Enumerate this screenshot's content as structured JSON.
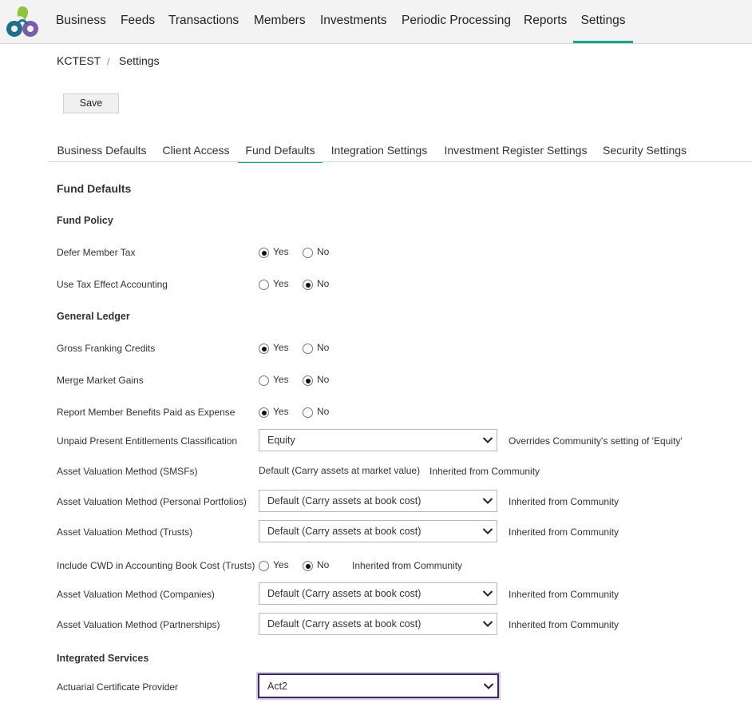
{
  "nav": {
    "items": [
      "Business",
      "Feeds",
      "Transactions",
      "Members",
      "Investments",
      "Periodic Processing",
      "Reports",
      "Settings"
    ],
    "active": "Settings"
  },
  "breadcrumb": {
    "root": "KCTEST",
    "separator": "/",
    "current": "Settings"
  },
  "toolbar": {
    "save_label": "Save"
  },
  "tabs": [
    "Business Defaults",
    "Client Access",
    "Fund Defaults",
    "Integration Settings",
    "Investment Register Settings",
    "Security Settings"
  ],
  "active_tab": "Fund Defaults",
  "section_title": "Fund Defaults",
  "radio_labels": {
    "yes": "Yes",
    "no": "No"
  },
  "fund_policy": {
    "heading": "Fund Policy",
    "defer_member_tax": {
      "label": "Defer Member Tax",
      "value": "Yes"
    },
    "use_tax_effect_accounting": {
      "label": "Use Tax Effect Accounting",
      "value": "No"
    }
  },
  "general_ledger": {
    "heading": "General Ledger",
    "gross_franking_credits": {
      "label": "Gross Franking Credits",
      "value": "Yes"
    },
    "merge_market_gains": {
      "label": "Merge Market Gains",
      "value": "No"
    },
    "report_member_benefits": {
      "label": "Report Member Benefits Paid as Expense",
      "value": "Yes"
    },
    "unpaid_present_entitlements": {
      "label": "Unpaid Present Entitlements Classification",
      "value": "Equity",
      "note": "Overrides Community's setting of 'Equity'"
    },
    "asset_valuation_smsfs": {
      "label": "Asset Valuation Method (SMSFs)",
      "value": "Default (Carry assets at market value)",
      "note": "Inherited from Community"
    },
    "asset_valuation_personal": {
      "label": "Asset Valuation Method (Personal Portfolios)",
      "value": "Default (Carry assets at book cost)",
      "note": "Inherited from Community"
    },
    "asset_valuation_trusts": {
      "label": "Asset Valuation Method (Trusts)",
      "value": "Default (Carry assets at book cost)",
      "note": "Inherited from Community"
    },
    "include_cwd": {
      "label": "Include CWD in Accounting Book Cost (Trusts)",
      "value": "No",
      "note": "Inherited from Community"
    },
    "asset_valuation_companies": {
      "label": "Asset Valuation Method (Companies)",
      "value": "Default (Carry assets at book cost)",
      "note": "Inherited from Community"
    },
    "asset_valuation_partnerships": {
      "label": "Asset Valuation Method (Partnerships)",
      "value": "Default (Carry assets at book cost)",
      "note": "Inherited from Community"
    }
  },
  "integrated_services": {
    "heading": "Integrated Services",
    "actuarial_certificate_provider": {
      "label": "Actuarial Certificate Provider",
      "value": "Act2"
    }
  },
  "colors": {
    "accent": "#1aa38b",
    "focus": "#3c2a5e"
  }
}
